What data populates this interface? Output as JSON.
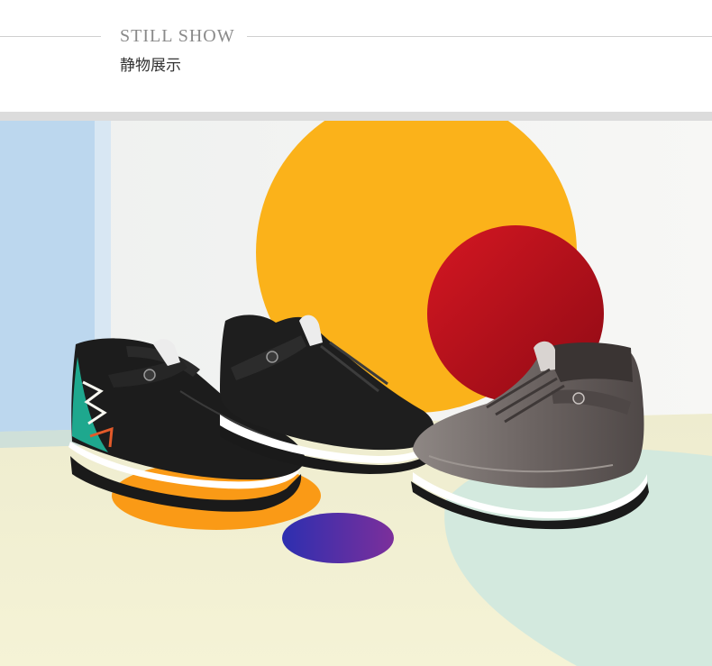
{
  "header": {
    "title_en": "STILL SHOW",
    "title_cn": "静物展示"
  },
  "photo": {
    "subject": "three-high-top-sneakers",
    "colors": {
      "wall": "#f4f4f2",
      "blue_panel": "#bcd7ee",
      "floor": "#f1efc9",
      "yellow_disc": "#fbb21a",
      "red_disc": "#c4101c",
      "orange_disc": "#fa9a16",
      "violet_disc": "#3b2ba8",
      "mint_disc": "#cfe8df",
      "black_leather": "#1c1c1c",
      "metallic_leather": "#77706e",
      "tribal_teal": "#1ea88e"
    }
  }
}
